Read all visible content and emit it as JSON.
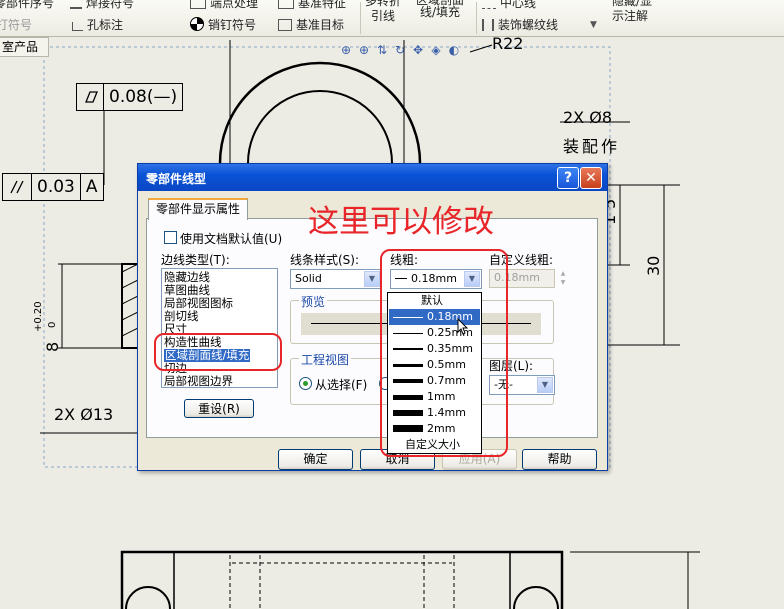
{
  "ribbon": {
    "items": [
      {
        "label": "零部件序号",
        "icon": "balloon-icon"
      },
      {
        "label": "焊接符号",
        "icon": "weld-symbol-icon"
      },
      {
        "label": "端点处理",
        "icon": "end-treatment-icon"
      },
      {
        "label": "基准特征",
        "icon": "datum-feature-icon"
      },
      {
        "label": "多转折引线",
        "icon": "multi-jog-leader-icon"
      },
      {
        "label": "区域剖面线/填充",
        "icon": "area-hatch-icon"
      },
      {
        "label": "中心线",
        "icon": "centerline-icon"
      },
      {
        "label": "隐藏/显示注解",
        "icon": "hide-show-annotations-icon"
      },
      {
        "label": "打符号",
        "icon": "stamp-symbol-icon"
      },
      {
        "label": "孔标注",
        "icon": "hole-callout-icon"
      },
      {
        "label": "销钉符号",
        "icon": "dowel-pin-symbol-icon"
      },
      {
        "label": "基准目标",
        "icon": "datum-target-icon"
      },
      {
        "label": "装饰螺纹线",
        "icon": "cosmetic-thread-icon"
      }
    ]
  },
  "tree_tab": {
    "label": "室产品"
  },
  "view_toolbar": {
    "icons": [
      "zoom-fit-icon",
      "zoom-area-icon",
      "zoom-in-out-icon",
      "rotate-icon",
      "pan-icon",
      "view-orientation-icon",
      "display-style-icon"
    ]
  },
  "drawing": {
    "dims": {
      "r22": "R22",
      "tol_flat": "0.08(—)",
      "tol_parallel": "0.03",
      "datum_a": "A",
      "holes_8": "2X Ø8",
      "assembly_note": "装配作",
      "dim_15": "15",
      "dim_30": "30",
      "dim_8_tol": "8",
      "dim_8_up": "+0.20",
      "dim_8_low": "0",
      "holes_13": "2X Ø13"
    },
    "symbols": {
      "flatness": "flatness-symbol-icon",
      "parallelism": "parallelism-symbol-icon"
    }
  },
  "dialog": {
    "title": "零部件线型",
    "help_label": "?",
    "close_label": "✕",
    "tab_label": "零部件显示属性",
    "use_doc_default": {
      "label": "使用文档默认值(U)",
      "checked": false
    },
    "edge_type_label": "边线类型(T):",
    "edge_types": [
      "隐藏边线",
      "草图曲线",
      "局部视图图标",
      "剖切线",
      "尺寸",
      "构造性曲线",
      "区域剖面线/填充",
      "切边",
      "局部视图边界"
    ],
    "selected_edge_type": "区域剖面线/填充",
    "reset_label": "重设(R)",
    "line_style_label": "线条样式(S):",
    "line_style_value": "Solid",
    "thickness_label": "线粗:",
    "thickness_value": "0.18mm",
    "custom_thickness_label": "自定义线粗:",
    "custom_thickness_value": "0.18mm",
    "preview_label": "预览",
    "drawing_view_label": "工程视图",
    "from_selection_label": "从选择(F)",
    "layer_label": "图层(L):",
    "layer_value": "-无-",
    "thickness_options": [
      {
        "label": "默认",
        "weight": 0
      },
      {
        "label": "0.18mm",
        "weight": 1
      },
      {
        "label": "0.25mm",
        "weight": 1
      },
      {
        "label": "0.35mm",
        "weight": 2
      },
      {
        "label": "0.5mm",
        "weight": 3
      },
      {
        "label": "0.7mm",
        "weight": 4
      },
      {
        "label": "1mm",
        "weight": 5
      },
      {
        "label": "1.4mm",
        "weight": 6
      },
      {
        "label": "2mm",
        "weight": 7
      },
      {
        "label": "自定义大小",
        "weight": 0
      }
    ],
    "selected_thickness": "0.18mm",
    "buttons": {
      "ok": "确定",
      "cancel": "取消",
      "apply": "应用(A)",
      "help": "帮助"
    }
  },
  "annotation": {
    "text": "这里可以修改",
    "color": "#e8262a"
  }
}
